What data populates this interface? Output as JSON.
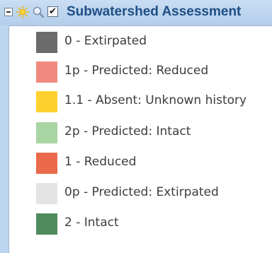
{
  "layer": {
    "title": "Subwatershed Assessment",
    "checked": true,
    "check_glyph": "✔",
    "collapse_state": "expanded"
  },
  "icons": {
    "sun": "sun-icon",
    "zoom": "zoom-icon",
    "collapse": "collapse-minus-icon",
    "checkbox": "checkbox-icon"
  },
  "legend": {
    "items": [
      {
        "label": "0 - Extirpated",
        "color": "#6b6b6b"
      },
      {
        "label": "1p - Predicted: Reduced",
        "color": "#f08a80"
      },
      {
        "label": "1.1 - Absent: Unknown history",
        "color": "#ffd12e"
      },
      {
        "label": "2p - Predicted: Intact",
        "color": "#a9d4a4"
      },
      {
        "label": "1 - Reduced",
        "color": "#ec6a4c"
      },
      {
        "label": "0p - Predicted: Extirpated",
        "color": "#e4e4e4"
      },
      {
        "label": "2 - Intact",
        "color": "#4f8a5c"
      }
    ]
  }
}
